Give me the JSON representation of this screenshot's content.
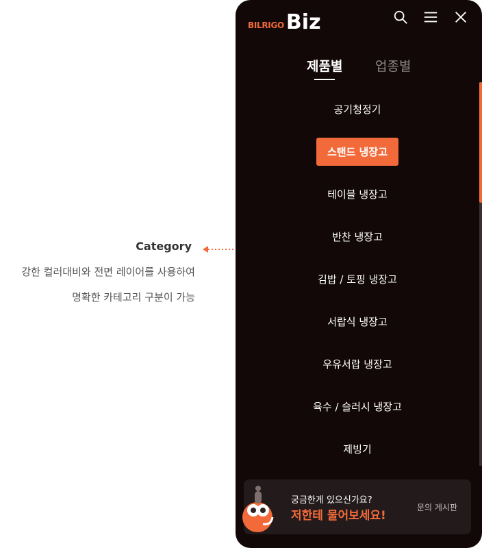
{
  "annotation": {
    "title": "Category",
    "line1": "강한 컬러대비와 전면 레이어를 사용하여",
    "line2": "명확한 카테고리 구분이 가능"
  },
  "header": {
    "logo_small": "BILRIGO",
    "logo_big": "Biz",
    "icons": [
      "search-icon",
      "menu-icon",
      "close-icon"
    ]
  },
  "tabs": [
    {
      "label": "제품별",
      "active": true
    },
    {
      "label": "업종별",
      "active": false
    }
  ],
  "menu": {
    "items": [
      {
        "label": "공기청정기",
        "active": false
      },
      {
        "label": "스탠드 냉장고",
        "active": true
      },
      {
        "label": "테이블 냉장고",
        "active": false
      },
      {
        "label": "반찬 냉장고",
        "active": false
      },
      {
        "label": "김밥 / 토핑 냉장고",
        "active": false
      },
      {
        "label": "서랍식 냉장고",
        "active": false
      },
      {
        "label": "우유서랍 냉장고",
        "active": false
      },
      {
        "label": "육수 / 슬러시 냉장고",
        "active": false
      },
      {
        "label": "제빙기",
        "active": false
      }
    ]
  },
  "banner": {
    "line1": "궁금한게 있으신가요?",
    "line2": "저한테 물어보세요!",
    "link": "문의 게시판"
  },
  "colors": {
    "panel_bg": "#120808",
    "accent": "#f26a3a",
    "text": "#ffffff",
    "inactive_tab": "#8d8686"
  }
}
